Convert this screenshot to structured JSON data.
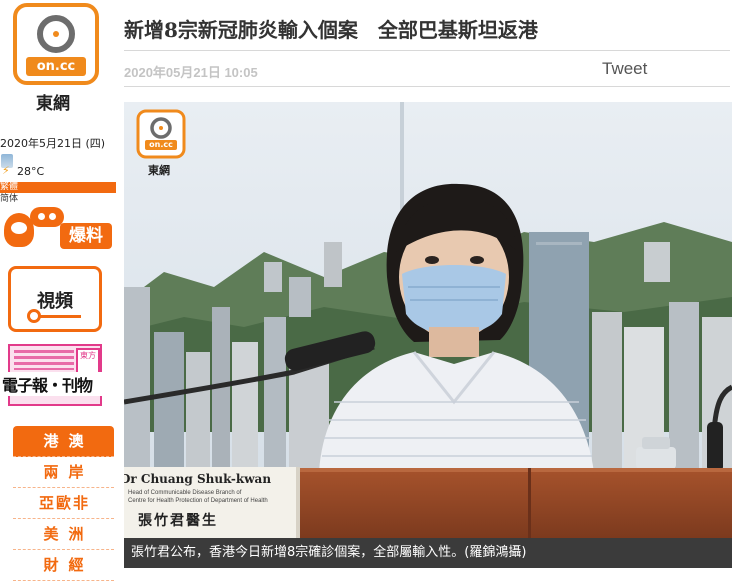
{
  "brand": {
    "logo_text": "on.cc",
    "name": "東網"
  },
  "sidebar": {
    "date": "2020年5月21日 (四)",
    "temperature": "28°C",
    "lang_traditional": "繁體",
    "lang_simplified": "简体",
    "baoliao_label": "爆料",
    "video_label": "視頻",
    "epaper_badge": "東方",
    "epaper_label": "電子報‧刊物",
    "regions": [
      {
        "label": "港澳",
        "active": true
      },
      {
        "label": "兩岸",
        "active": false
      },
      {
        "label": "亞歐非",
        "active": false
      },
      {
        "label": "美洲",
        "active": false
      },
      {
        "label": "財經",
        "active": false
      }
    ]
  },
  "article": {
    "headline": "新增8宗新冠肺炎輸入個案　全部巴基斯坦返港",
    "published": "2020年05月21日 10:05",
    "tweet_label": "Tweet",
    "photo": {
      "watermark_logo": "on.cc",
      "watermark_name": "東網",
      "nameplate_en": "Dr Chuang Shuk-kwan",
      "nameplate_title_1": "Head of Communicable Disease Branch of",
      "nameplate_title_2": "Centre for Health Protection of Department of Health",
      "nameplate_cn": "張竹君醫生"
    },
    "caption": "張竹君公布，香港今日新增8宗確診個案，全部屬輸入性。(羅錦鴻攝)"
  },
  "colors": {
    "brand_orange": "#f26a10",
    "headline": "#333333",
    "caption_bg": "#3b3b3b"
  }
}
